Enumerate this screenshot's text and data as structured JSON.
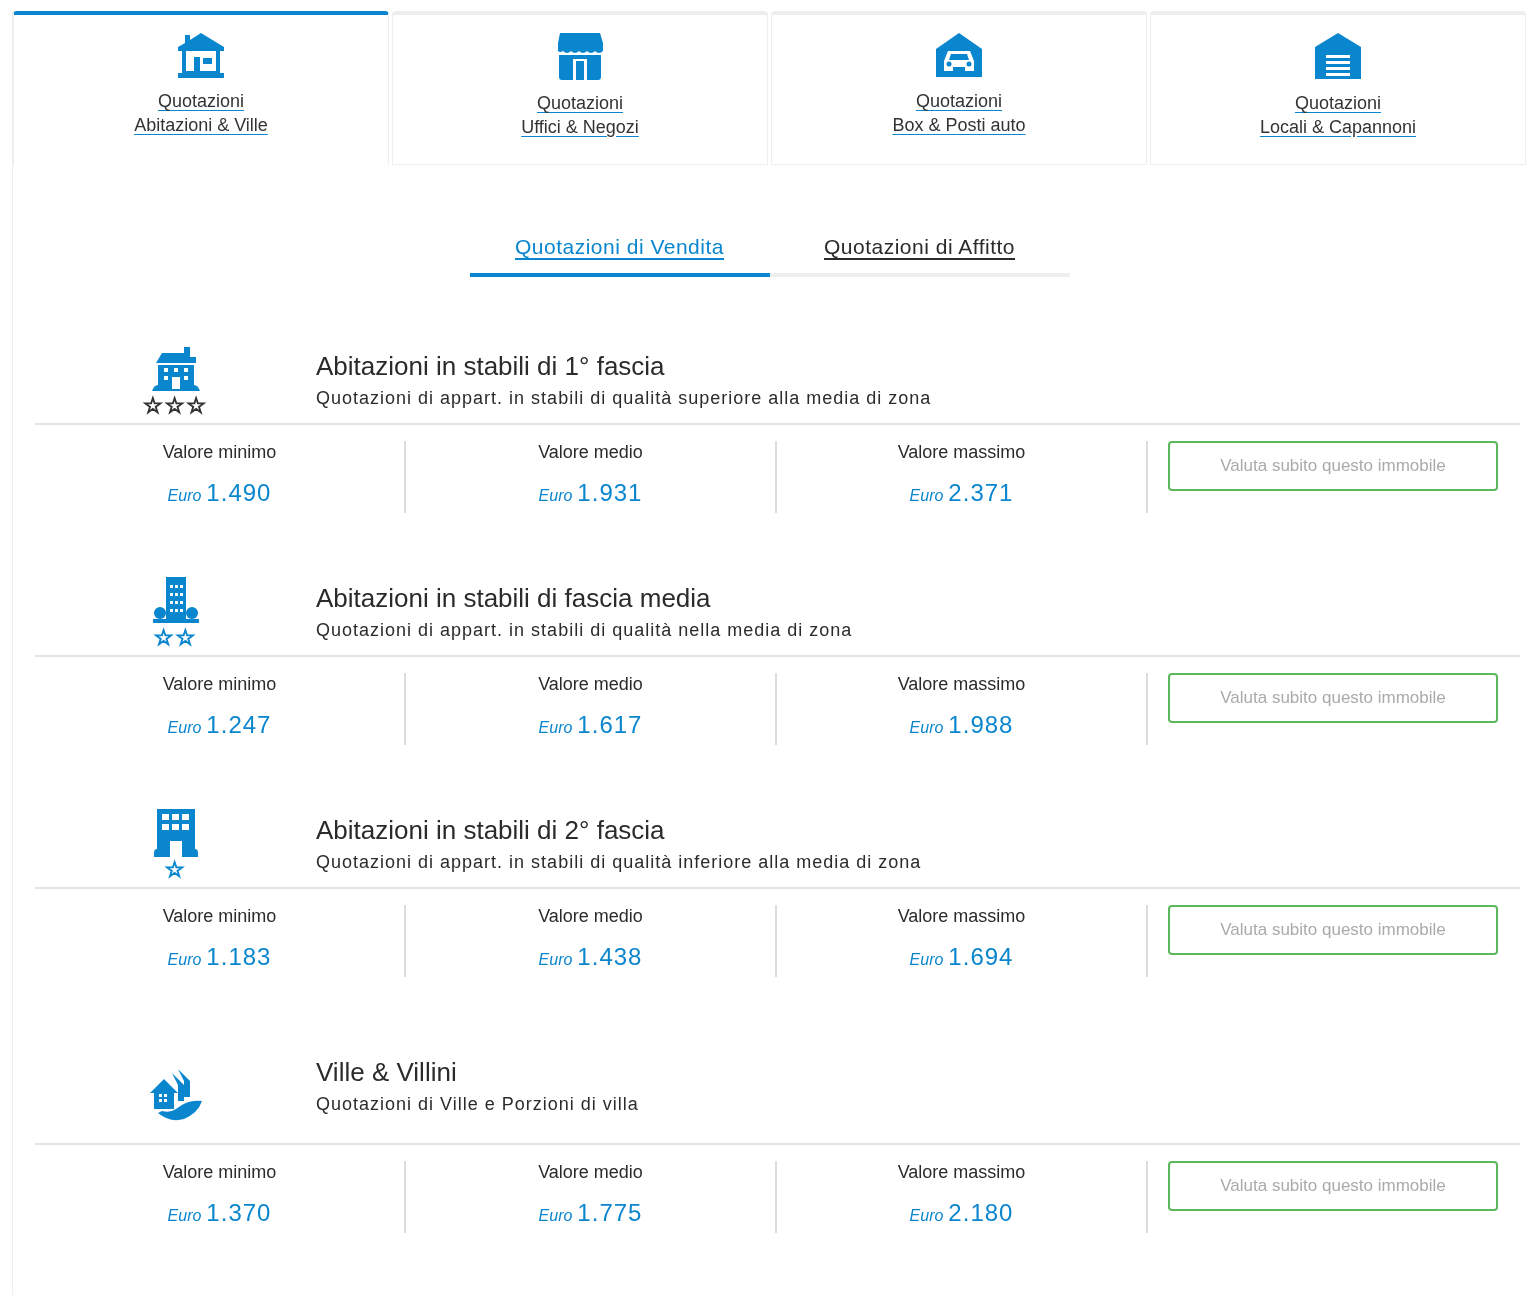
{
  "property_tabs": [
    {
      "kind": "house",
      "lines": [
        "Quotazioni",
        "Abitazioni & Ville"
      ],
      "selected": true
    },
    {
      "kind": "shop",
      "lines": [
        "Quotazioni",
        "Uffici & Negozi"
      ],
      "selected": false
    },
    {
      "kind": "garage",
      "lines": [
        "Quotazioni",
        "Box & Posti auto"
      ],
      "selected": false
    },
    {
      "kind": "warehouse",
      "lines": [
        "Quotazioni",
        "Locali & Capannoni"
      ],
      "selected": false
    }
  ],
  "mode_tabs": [
    {
      "label": "Quotazioni di Vendita",
      "selected": true
    },
    {
      "label": "Quotazioni di Affitto",
      "selected": false
    }
  ],
  "categories": [
    {
      "kind": "mansion",
      "title": "Abitazioni in stabili di 1° fascia",
      "subtitle": "Quotazioni di appart. in stabili di qualità superiore alla media di zona",
      "rating": "☆☆☆",
      "color": "#333333",
      "values": [
        {
          "label": "Valore minimo",
          "currency": "Euro",
          "amount": "1.490"
        },
        {
          "label": "Valore medio",
          "currency": "Euro",
          "amount": "1.931"
        },
        {
          "label": "Valore massimo",
          "currency": "Euro",
          "amount": "2.371"
        }
      ],
      "button": "Valuta subito questo immobile"
    },
    {
      "kind": "tower",
      "title": "Abitazioni in stabili di fascia media",
      "subtitle": "Quotazioni di appart. in stabili di qualità nella media di zona",
      "rating": "☆☆",
      "color": "#0a86cf",
      "values": [
        {
          "label": "Valore minimo",
          "currency": "Euro",
          "amount": "1.247"
        },
        {
          "label": "Valore medio",
          "currency": "Euro",
          "amount": "1.617"
        },
        {
          "label": "Valore massimo",
          "currency": "Euro",
          "amount": "1.988"
        }
      ],
      "button": "Valuta subito questo immobile"
    },
    {
      "kind": "block",
      "title": "Abitazioni in stabili di 2° fascia",
      "subtitle": "Quotazioni di appart. in stabili di qualità inferiore alla media di zona",
      "rating": "☆",
      "color": "#0a86cf",
      "values": [
        {
          "label": "Valore minimo",
          "currency": "Euro",
          "amount": "1.183"
        },
        {
          "label": "Valore medio",
          "currency": "Euro",
          "amount": "1.438"
        },
        {
          "label": "Valore massimo",
          "currency": "Euro",
          "amount": "1.694"
        }
      ],
      "button": "Valuta subito questo immobile"
    },
    {
      "kind": "villa",
      "title": "Ville & Villini",
      "subtitle": "Quotazioni di Ville e Porzioni di villa",
      "values": [
        {
          "label": "Valore minimo",
          "currency": "Euro",
          "amount": "1.370"
        },
        {
          "label": "Valore medio",
          "currency": "Euro",
          "amount": "1.775"
        },
        {
          "label": "Valore massimo",
          "currency": "Euro",
          "amount": "2.180"
        }
      ],
      "button": "Valuta subito questo immobile"
    }
  ]
}
